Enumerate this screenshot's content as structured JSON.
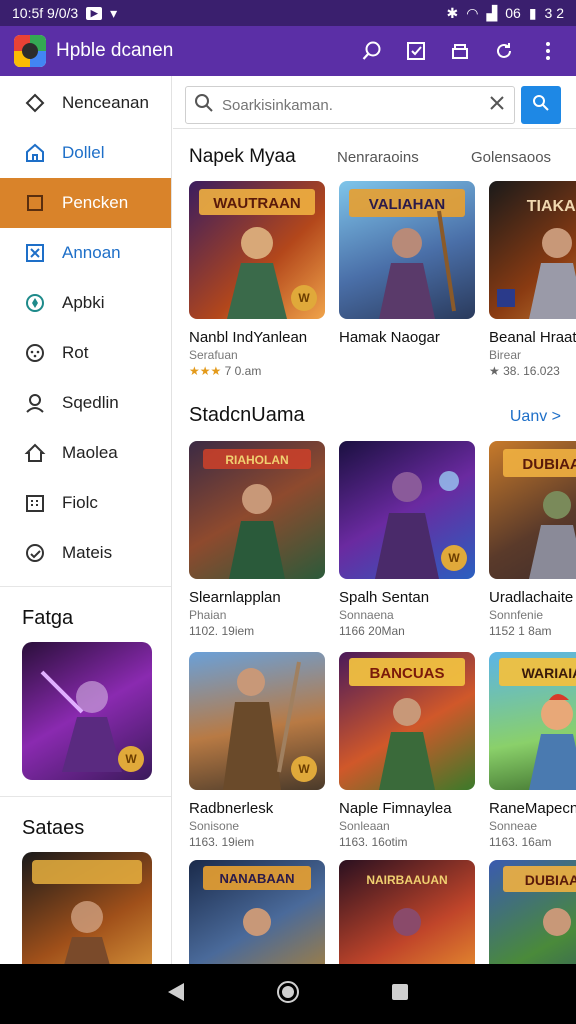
{
  "status_bar": {
    "time": "10:5f 9/0/3",
    "battery": "3 2",
    "signal": "06"
  },
  "app": {
    "title": "Hpble dcanen"
  },
  "sidebar": {
    "items": [
      {
        "label": "Nenceanan",
        "icon": "move-icon"
      },
      {
        "label": "Dollel",
        "icon": "home-icon"
      },
      {
        "label": "Pencken",
        "icon": "square-icon"
      },
      {
        "label": "Annoan",
        "icon": "grid-icon"
      },
      {
        "label": "Apbki",
        "icon": "compass-icon"
      },
      {
        "label": "Rot",
        "icon": "smile-icon"
      },
      {
        "label": "Sqedlin",
        "icon": "person-icon"
      },
      {
        "label": "Maolea",
        "icon": "house-outline-icon"
      },
      {
        "label": "Fiolc",
        "icon": "calendar-icon"
      },
      {
        "label": "Mateis",
        "icon": "check-circle-icon"
      }
    ],
    "section1_title": "Fatga",
    "section2_title": "Sataes",
    "badge": "W"
  },
  "search": {
    "placeholder": "Soarkisinkaman."
  },
  "tabs": {
    "primary": "Napek Myaa",
    "second": "Nenraraoins",
    "third": "Golensaoos"
  },
  "top_row": [
    {
      "thumb_label": "WAUTRAAN",
      "title": "Nanbl IndYanlean",
      "sub": "Serafuan",
      "stars": "★★★",
      "meta": "7 0.am"
    },
    {
      "thumb_label": "VALIAHAN",
      "title": "Hamak Naogar",
      "sub": "",
      "stars": "",
      "meta": ""
    },
    {
      "thumb_label": "TIAKAN",
      "title": "Beanal Hraaton",
      "sub": "Birear",
      "stars": "★",
      "meta": "38. 16.023"
    }
  ],
  "section": {
    "title": "StadcnUama",
    "view_all": "Uanv >"
  },
  "grid": [
    {
      "thumb_label": "RIAHOLAN",
      "title": "Slearnlapplan",
      "sub": "Phaian",
      "meta": "1102. 19iem"
    },
    {
      "thumb_label": "",
      "title": "Spalh Sentan",
      "sub": "Sonnaena",
      "meta": "1166 20Man"
    },
    {
      "thumb_label": "DUBIAAN",
      "title": "Uradlachaite",
      "sub": "Sonnfenie",
      "meta": "1152 1 8am"
    },
    {
      "thumb_label": "",
      "title": "Radbnerlesk",
      "sub": "Sonisone",
      "meta": "1163. 19iem"
    },
    {
      "thumb_label": "BANCUAS",
      "title": "Naple Fimnaylea",
      "sub": "Sonleaan",
      "meta": "1163. 16otim"
    },
    {
      "thumb_label": "WARIAIAN",
      "title": "RaneMapecn",
      "sub": "Sonneae",
      "meta": "1163. 16am"
    },
    {
      "thumb_label": "NANABAAN",
      "title": "",
      "sub": "",
      "meta": ""
    },
    {
      "thumb_label": "NAIRBAAUAN",
      "title": "",
      "sub": "",
      "meta": ""
    },
    {
      "thumb_label": "DUBIAAN",
      "title": "",
      "sub": "",
      "meta": ""
    }
  ],
  "colors": {
    "appbar": "#5b2fa6",
    "accent": "#d9832a",
    "link": "#1e6fc8",
    "search_button": "#1e88e5"
  }
}
